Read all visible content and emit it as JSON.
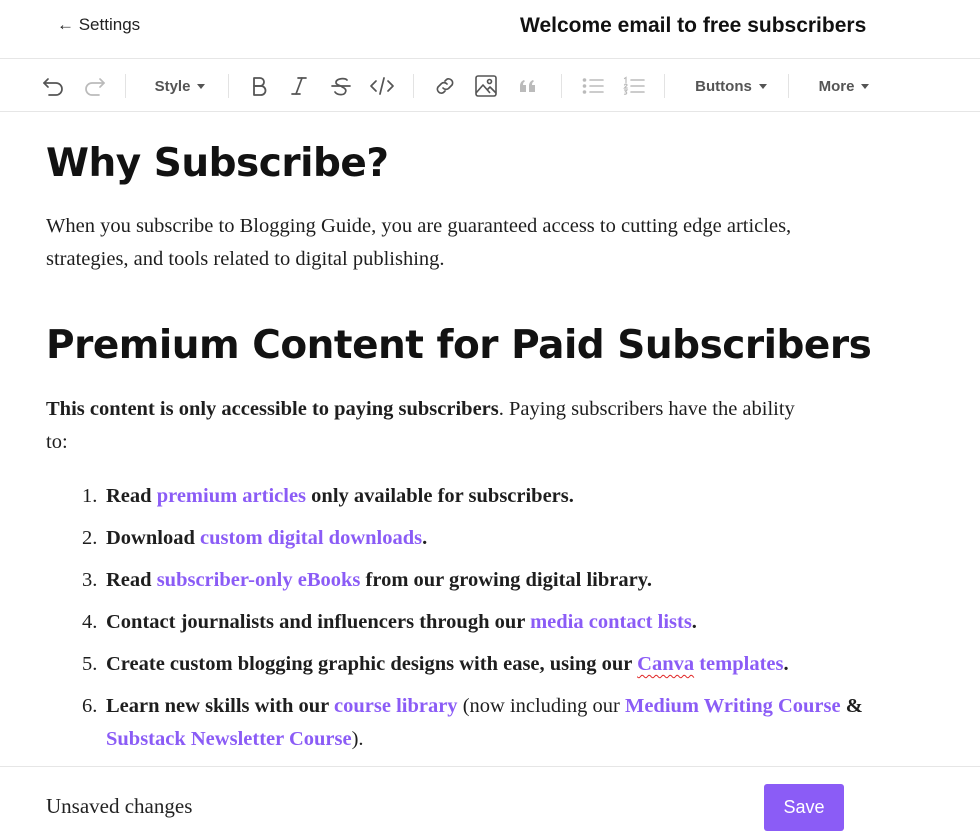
{
  "header": {
    "back_label": "← Settings",
    "title": "Welcome email to free subscribers"
  },
  "toolbar": {
    "style_label": "Style",
    "buttons_label": "Buttons",
    "more_label": "More",
    "icons": [
      "undo-icon",
      "redo-icon",
      "bold-icon",
      "italic-icon",
      "strikethrough-icon",
      "code-icon",
      "link-icon",
      "image-icon",
      "quote-icon",
      "bullet-list-icon",
      "numbered-list-icon"
    ]
  },
  "content": {
    "heading1": "Why Subscribe?",
    "para1": "When you subscribe to Blogging Guide, you are guaranteed access to cutting edge articles, strategies, and tools related to digital publishing.",
    "heading2": "Premium Content for Paid Subscribers",
    "para2_bold": "This content is only accessible to paying subscribers",
    "para2_rest": ". Paying subscribers have the ability to:",
    "list": [
      {
        "num": "1.",
        "before": "Read ",
        "link": "premium articles",
        "after": " only available for subscribers."
      },
      {
        "num": "2.",
        "before": "Download ",
        "link": "custom digital downloads",
        "after": "."
      },
      {
        "num": "3.",
        "before": "Read ",
        "link": "subscriber-only eBooks",
        "after": " from our growing digital library."
      },
      {
        "num": "4.",
        "before": "Contact journalists and influencers through our ",
        "link": "media contact lists",
        "after": "."
      },
      {
        "num": "5.",
        "before": "Create custom blogging graphic designs with ease, using our ",
        "link_a": "Canva",
        "link_b": " templates",
        "after": "."
      },
      {
        "num": "6.",
        "before": "Learn new skills with our ",
        "link": "course library",
        "mid1": " (now including our ",
        "link2": "Medium Writing Course",
        "mid2": " & ",
        "link3": "Substack Newsletter Course",
        "after": ")."
      }
    ]
  },
  "footer": {
    "status": "Unsaved changes",
    "save_label": "Save"
  },
  "colors": {
    "accent": "#8b5cf6",
    "spellcheck": "#e02424"
  }
}
